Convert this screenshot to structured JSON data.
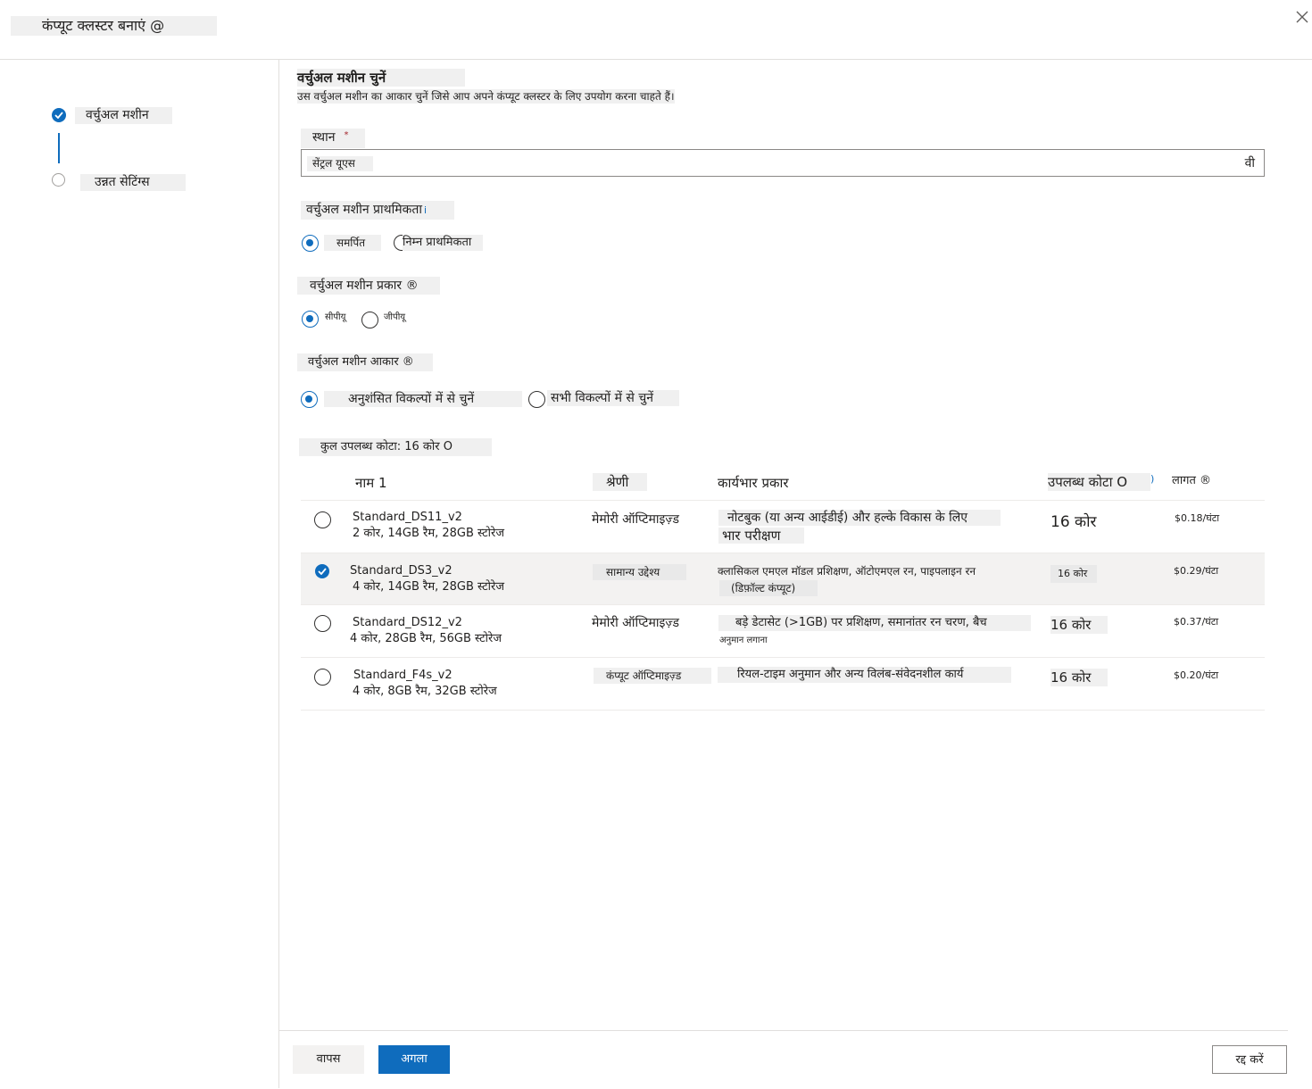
{
  "header": {
    "title": "कंप्यूट क्लस्टर बनाएं @",
    "close_icon": "close-icon"
  },
  "nav": {
    "steps": [
      {
        "label": "वर्चुअल मशीन",
        "status": "complete"
      },
      {
        "label": "उन्नत सेटिंग्स",
        "status": "pending"
      }
    ]
  },
  "main": {
    "title": "वर्चुअल मशीन चुनें",
    "subtitle": "उस वर्चुअल मशीन का आकार चुनें जिसे आप अपने कंप्यूट क्लस्टर के लिए उपयोग करना चाहते हैं।",
    "location": {
      "label": "स्थान",
      "required_mark": "*",
      "value": "सेंट्रल यूएस",
      "chevron": "वी"
    },
    "priority": {
      "label": "वर्चुअल मशीन प्राथमिकता",
      "info": "i",
      "options": [
        "समर्पित",
        "निम्न प्राथमिकता"
      ],
      "selected": 0
    },
    "vm_type": {
      "label": "वर्चुअल मशीन प्रकार ®",
      "options": [
        "सीपीयू",
        "जीपीयू"
      ],
      "selected": 0
    },
    "vm_size": {
      "label": "वर्चुअल मशीन आकार ®",
      "options": [
        "अनुशंसित विकल्पों में से चुनें",
        "सभी विकल्पों में से चुनें"
      ],
      "selected": 0
    },
    "quota": "कुल उपलब्ध कोटा: 16 कोर O",
    "table": {
      "headers": {
        "name": "नाम 1",
        "category": "श्रेणी",
        "workload": "कार्यभार प्रकार",
        "quota": "उपलब्ध कोटा O",
        "quota_info": ")",
        "cost": "लागत ®"
      },
      "rows": [
        {
          "name": "Standard_DS11_v2",
          "specs": "2 कोर, 14GB रैम, 28GB स्टोरेज",
          "category": "मेमोरी ऑप्टिमाइज़्ड",
          "workload1": "नोटबुक (या अन्य आईडीई) और हल्के विकास के लिए",
          "workload2": "भार परीक्षण",
          "quota": "16 कोर",
          "cost": "$0.18/घंटा",
          "selected": false
        },
        {
          "name": "Standard_DS3_v2",
          "specs": "4 कोर, 14GB रैम, 28GB स्टोरेज",
          "category": "सामान्य उद्देश्य",
          "workload1": "क्लासिकल एमएल मॉडल प्रशिक्षण, ऑटोएमएल रन, पाइपलाइन रन",
          "workload2": "(डिफ़ॉल्ट कंप्यूट)",
          "quota": "16 कोर",
          "cost": "$0.29/घंटा",
          "selected": true
        },
        {
          "name": "Standard_DS12_v2",
          "specs": "4 कोर, 28GB रैम, 56GB स्टोरेज",
          "category": "मेमोरी ऑप्टिमाइज़्ड",
          "workload1": "बड़े डेटासेट (>1GB) पर प्रशिक्षण, समानांतर रन चरण, बैच",
          "workload2": "अनुमान लगाना",
          "quota": "16 कोर",
          "cost": "$0.37/घंटा",
          "selected": false
        },
        {
          "name": "Standard_F4s_v2",
          "specs": "4 कोर, 8GB रैम, 32GB स्टोरेज",
          "category": "कंप्यूट ऑप्टिमाइज़्ड",
          "workload1": "रियल-टाइम अनुमान और अन्य विलंब-संवेदनशील कार्य",
          "workload2": "",
          "quota": "16 कोर",
          "cost": "$0.20/घंटा",
          "selected": false
        }
      ]
    }
  },
  "footer": {
    "back": "वापस",
    "next": "अगला",
    "cancel": "रद्द करें"
  },
  "colors": {
    "accent": "#0f6cbd",
    "selected_row": "#f3f2f1"
  }
}
